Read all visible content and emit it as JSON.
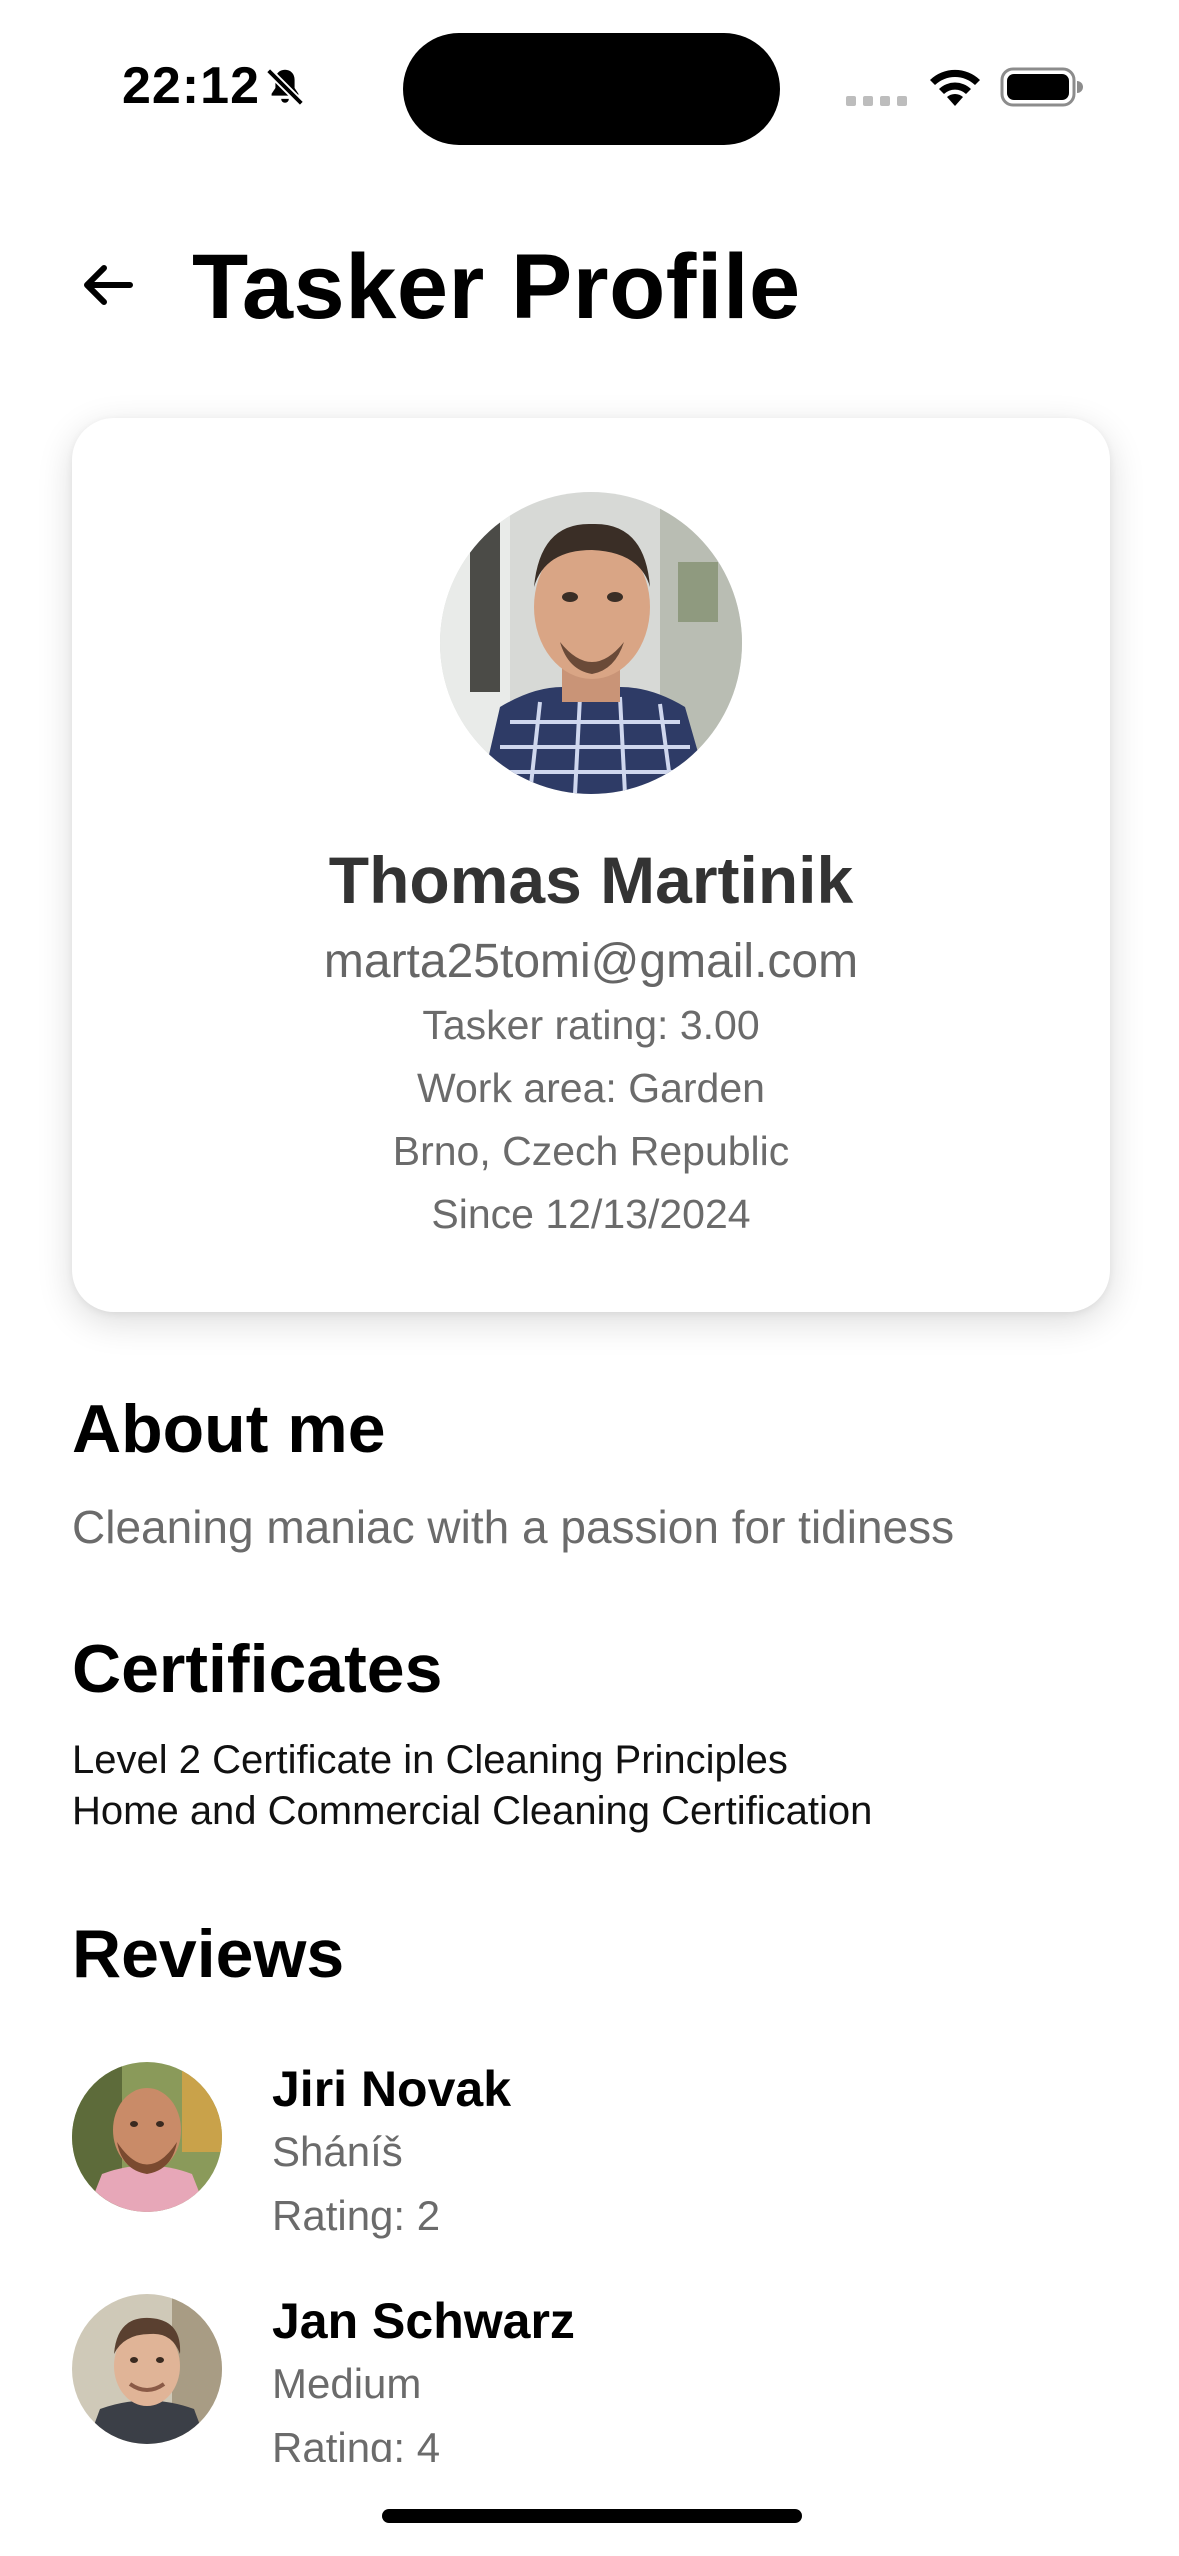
{
  "status_bar": {
    "time": "22:12",
    "icons": [
      "bell-slash-icon",
      "cellular-signal-icon",
      "wifi-icon",
      "battery-icon"
    ]
  },
  "header": {
    "title": "Tasker Profile",
    "back_icon": "arrow-left-icon"
  },
  "profile": {
    "name": "Thomas Martinik",
    "email": "marta25tomi@gmail.com",
    "rating": "Tasker rating: 3.00",
    "work_area": "Work area: Garden",
    "location": "Brno, Czech Republic",
    "since": "Since 12/13/2024"
  },
  "about": {
    "heading": "About me",
    "text": "Cleaning maniac with a passion for tidiness"
  },
  "certificates": {
    "heading": "Certificates",
    "items": [
      "Level 2 Certificate in Cleaning Principles",
      "Home and Commercial Cleaning Certification"
    ]
  },
  "reviews": {
    "heading": "Reviews",
    "items": [
      {
        "name": "Jiri Novak",
        "comment": "Sháníš",
        "rating": "Rating: 2"
      },
      {
        "name": "Jan Schwarz",
        "comment": "Medium",
        "rating": "Rating: 4"
      }
    ]
  },
  "colors": {
    "background": "#ffffff",
    "text_primary": "#000000",
    "text_secondary": "#6b6b6b",
    "name_text": "#333333"
  }
}
